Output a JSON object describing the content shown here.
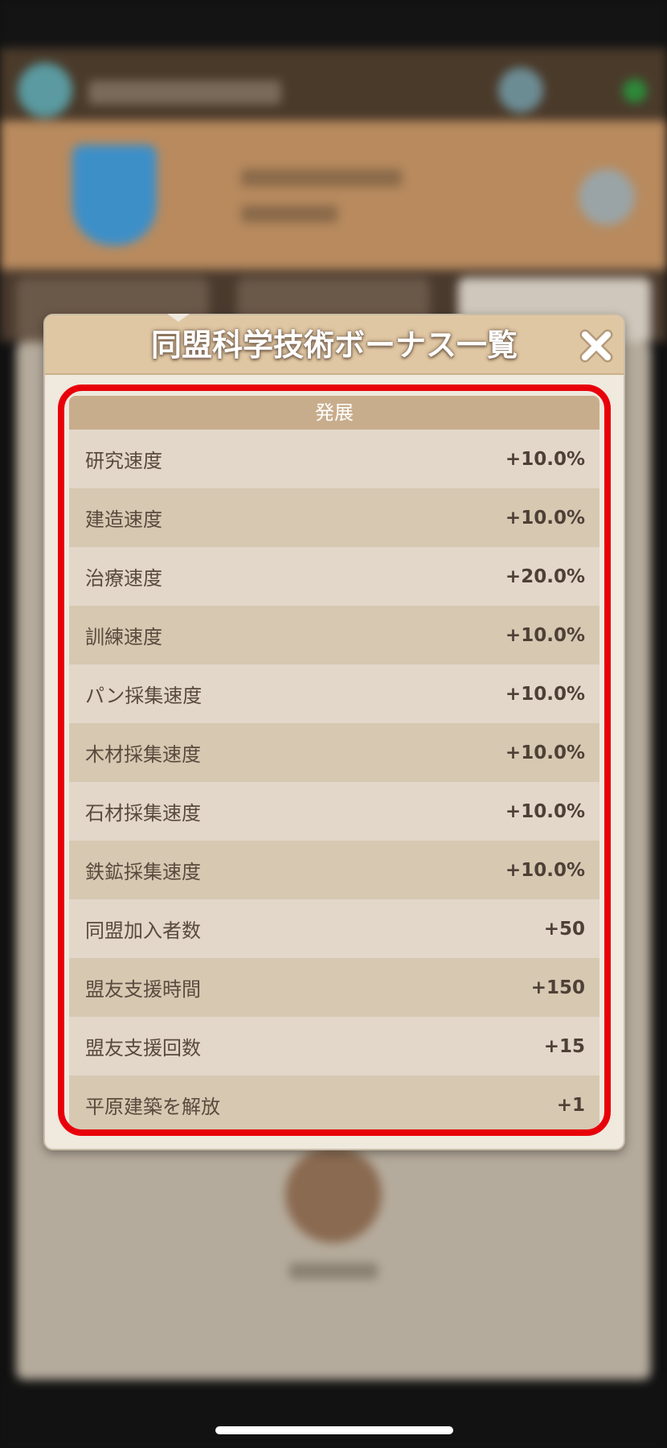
{
  "modal": {
    "title": "同盟科学技術ボーナス一覧",
    "close_icon": "close-icon",
    "section_title": "発展",
    "rows": [
      {
        "label": "研究速度",
        "value": "+10.0%"
      },
      {
        "label": "建造速度",
        "value": "+10.0%"
      },
      {
        "label": "治療速度",
        "value": "+20.0%"
      },
      {
        "label": "訓練速度",
        "value": "+10.0%"
      },
      {
        "label": "パン採集速度",
        "value": "+10.0%"
      },
      {
        "label": "木材採集速度",
        "value": "+10.0%"
      },
      {
        "label": "石材採集速度",
        "value": "+10.0%"
      },
      {
        "label": "鉄鉱採集速度",
        "value": "+10.0%"
      },
      {
        "label": "同盟加入者数",
        "value": "+50"
      },
      {
        "label": "盟友支援時間",
        "value": "+150"
      },
      {
        "label": "盟友支援回数",
        "value": "+15"
      },
      {
        "label": "平原建築を解放",
        "value": "+1"
      }
    ]
  },
  "colors": {
    "highlight": "#e8000a",
    "header_bg": "#e0c7a3",
    "section_bg": "#c8ad8c"
  }
}
